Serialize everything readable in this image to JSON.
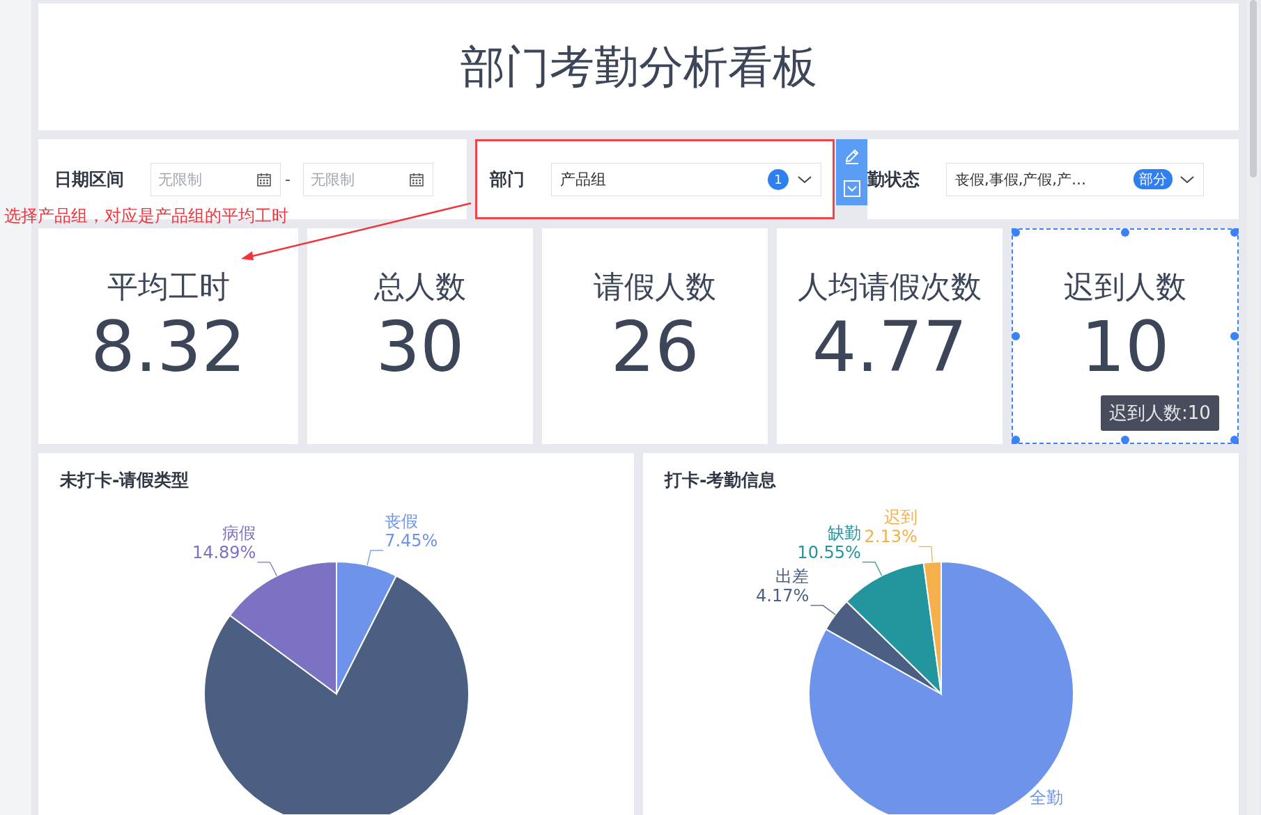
{
  "title": "部门考勤分析看板",
  "filters": {
    "date_range": {
      "label": "日期区间",
      "start": {
        "placeholder": "无限制"
      },
      "separator": "-",
      "end": {
        "placeholder": "无限制"
      }
    },
    "department": {
      "label": "部门",
      "value": "产品组",
      "count_badge": "1",
      "highlighted": true
    },
    "attendance_status": {
      "label": "勤状态",
      "value": "丧假,事假,产假,产…",
      "badge": "部分"
    }
  },
  "annotation": {
    "text": "选择产品组，对应是产品组的平均工时"
  },
  "kpi_cards": [
    {
      "label": "平均工时",
      "value": "8.32",
      "selected": false
    },
    {
      "label": "总人数",
      "value": "30",
      "selected": false
    },
    {
      "label": "请假人数",
      "value": "26",
      "selected": false
    },
    {
      "label": "人均请假次数",
      "value": "4.77",
      "selected": false
    },
    {
      "label": "迟到人数",
      "value": "10",
      "selected": true,
      "tooltip": "迟到人数:10"
    }
  ],
  "charts": [
    {
      "title": "未打卡-请假类型",
      "chart_data": {
        "type": "pie",
        "categories": [
          "丧假",
          null,
          "病假"
        ],
        "values": [
          7.45,
          77.66,
          14.89
        ],
        "colors": [
          "#6e93ea",
          "#4a5f82",
          "#7b72c4"
        ],
        "value_labels": [
          "7.45%",
          null,
          "14.89%"
        ]
      }
    },
    {
      "title": "打卡-考勤信息",
      "chart_data": {
        "type": "pie",
        "categories": [
          "全勤",
          "出差",
          "缺勤",
          "迟到"
        ],
        "values": [
          83.15,
          4.17,
          10.55,
          2.13
        ],
        "colors": [
          "#6e93ea",
          "#4a5f82",
          "#23959f",
          "#f5b04c"
        ],
        "value_labels": [
          null,
          "4.17%",
          "10.55%",
          "2.13%"
        ]
      }
    }
  ]
}
